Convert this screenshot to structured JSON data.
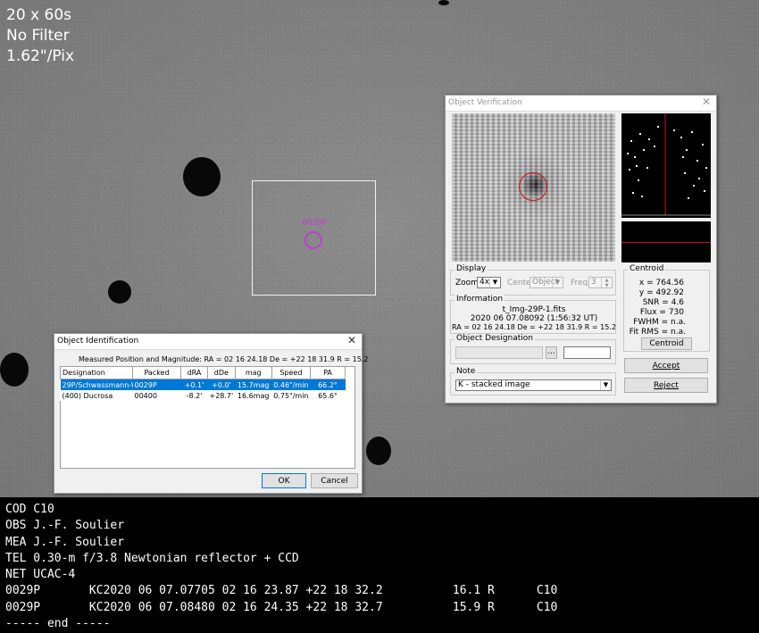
{
  "image_overlay": {
    "lines": [
      "20 x 60s",
      "No Filter",
      "1.62\"/Pix"
    ]
  },
  "target_label": "0029P",
  "object_identification": {
    "title": "Object Identification",
    "close_glyph": "✕",
    "measured": "Measured Position and Magnitude: RA = 02 16 24.18   De = +22 18 31.9   R = 15.2",
    "columns": [
      "Designation",
      "Packed",
      "dRA",
      "dDe",
      "mag",
      "Speed",
      "PA"
    ],
    "rows": [
      [
        "29P/Schwassmann-Wa",
        "0029P",
        "+0.1'",
        "+0.0'",
        "15.7mag",
        "0.46\"/min",
        "66.2°"
      ],
      [
        "(400) Ducrosa",
        "00400",
        "-8.2'",
        "+28.7'",
        "16.6mag",
        "0.75\"/min",
        "65.6°"
      ]
    ],
    "ok": "OK",
    "cancel": "Cancel"
  },
  "object_verification": {
    "title": "Object Verification",
    "close_glyph": "✕",
    "display": {
      "title": "Display",
      "zoom_label": "Zoom",
      "zoom_value": "4x",
      "center_label": "Center",
      "center_value": "Object",
      "freq_label": "Freq",
      "freq_value": "3"
    },
    "information": {
      "title": "Information",
      "file": "t_Img-29P-1.fits",
      "datetime": "2020 06 07.08092 (1:56:32 UT)",
      "position": "RA = 02 16 24.18   De = +22 18 31.9   R = 15.2"
    },
    "designation": {
      "title": "Object Designation",
      "browse": "..."
    },
    "note": {
      "title": "Note",
      "value": "K - stacked image"
    },
    "centroid": {
      "title": "Centroid",
      "x": "x = 764.56",
      "y": "y = 492.92",
      "snr": "SNR = 4.6",
      "flux": "Flux = 730",
      "fwhm": "FWHM = n.a.",
      "fitrms": "Fit RMS = n.a.",
      "button": "Centroid"
    },
    "accept": "Accept",
    "reject": "Reject"
  },
  "mpc_report": {
    "lines": [
      "COD C10",
      "OBS J.-F. Soulier",
      "MEA J.-F. Soulier",
      "TEL 0.30-m f/3.8 Newtonian reflector + CCD",
      "NET UCAC-4",
      "0029P       KC2020 06 07.07705 02 16 23.87 +22 18 32.2          16.1 R      C10",
      "0029P       KC2020 06 07.08480 02 16 24.35 +22 18 32.7          15.9 R      C10",
      "----- end -----"
    ]
  },
  "colors": {
    "target": "#c23bd4",
    "selection": "#0078d7",
    "crosshair": "#d01010"
  }
}
